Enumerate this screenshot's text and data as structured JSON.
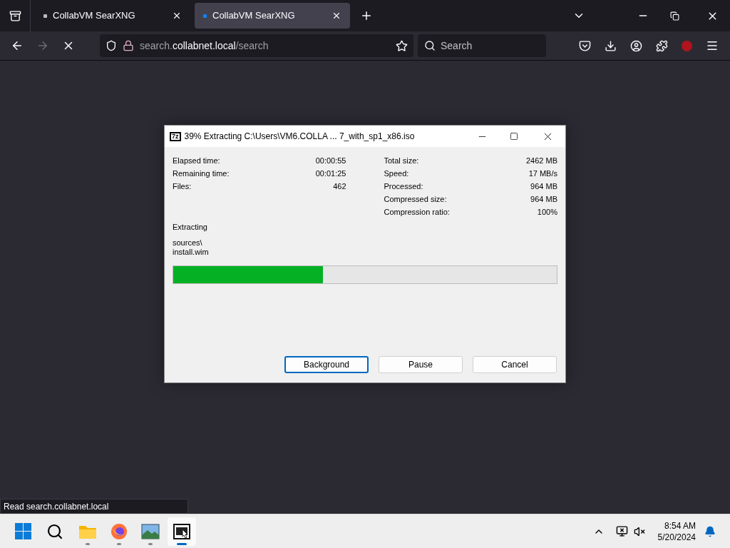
{
  "browser": {
    "tabs": [
      {
        "title": "CollabVM SearXNG",
        "selected": false
      },
      {
        "title": "CollabVM SearXNG",
        "selected": true
      }
    ],
    "url": {
      "host_prefix": "search.",
      "host": "collabnet.local",
      "path": "/search"
    },
    "search": {
      "placeholder": "Search"
    },
    "status_text": "Read search.collabnet.local"
  },
  "dialog": {
    "app_icon_label": "7z",
    "title": "39% Extracting C:\\Users\\VM6.COLLA ... 7_with_sp1_x86.iso",
    "left_stats": [
      {
        "label": "Elapsed time:",
        "value": "00:00:55"
      },
      {
        "label": "Remaining time:",
        "value": "00:01:25"
      },
      {
        "label": "Files:",
        "value": "462"
      }
    ],
    "right_stats": [
      {
        "label": "Total size:",
        "value": "2462 MB"
      },
      {
        "label": "Speed:",
        "value": "17 MB/s"
      },
      {
        "label": "Processed:",
        "value": "964 MB"
      },
      {
        "label": "Compressed size:",
        "value": "964 MB"
      },
      {
        "label": "Compression ratio:",
        "value": "100%"
      }
    ],
    "operation": "Extracting",
    "current_file": [
      "sources\\",
      "install.wim"
    ],
    "progress": {
      "level": 0.39
    },
    "buttons": [
      {
        "label": "Background",
        "selected": true
      },
      {
        "label": "Pause",
        "selected": false
      },
      {
        "label": "Cancel",
        "selected": false
      }
    ]
  },
  "taskbar": {
    "apps": [
      {
        "kind": "folder",
        "selected": false
      },
      {
        "kind": "browser",
        "selected": false
      },
      {
        "kind": "image",
        "selected": false
      },
      {
        "kind": "archiver",
        "selected": true
      }
    ],
    "time": "8:54 AM",
    "date": "5/20/2024"
  }
}
